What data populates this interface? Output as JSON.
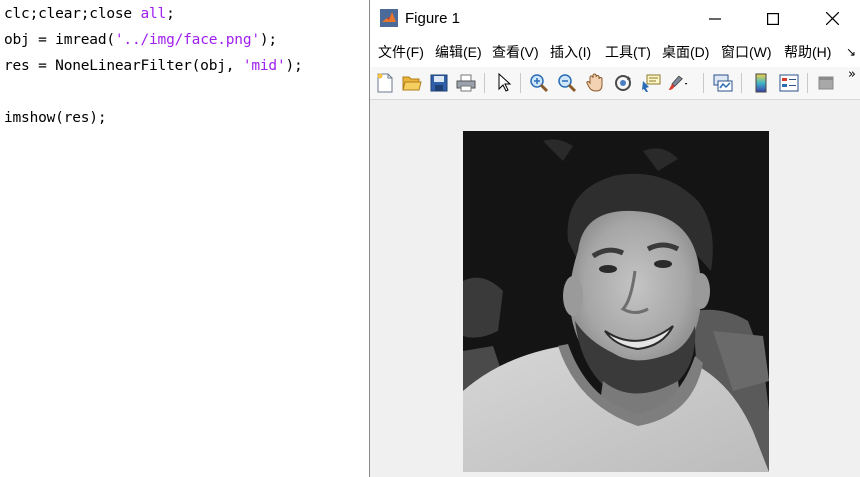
{
  "editor": {
    "lines": [
      {
        "parts": [
          "clc;clear;close ",
          "all",
          ";"
        ]
      },
      {
        "parts": [
          "obj = imread(",
          "'../img/face.png'",
          ");"
        ]
      },
      {
        "parts": [
          "res = NoneLinearFilter(obj, ",
          "'mid'",
          ");"
        ]
      },
      {
        "parts": [
          ""
        ]
      },
      {
        "parts": [
          "imshow(res);"
        ]
      }
    ],
    "string_color": "#a020f0"
  },
  "figure": {
    "title": "Figure 1",
    "window_buttons": {
      "minimize": "minimize-icon",
      "maximize": "maximize-icon",
      "close": "close-icon"
    },
    "menus": [
      "文件(F)",
      "编辑(E)",
      "查看(V)",
      "插入(I)",
      "工具(T)",
      "桌面(D)",
      "窗口(W)",
      "帮助(H)"
    ],
    "menu_overflow": "↘",
    "toolbar_overflow": "»",
    "toolbar": [
      {
        "icon": "new-figure-icon"
      },
      {
        "icon": "open-file-icon"
      },
      {
        "icon": "save-icon"
      },
      {
        "icon": "print-icon"
      },
      {
        "icon": "pointer-icon"
      },
      {
        "icon": "zoom-in-icon"
      },
      {
        "icon": "zoom-out-icon"
      },
      {
        "icon": "pan-hand-icon"
      },
      {
        "icon": "rotate-3d-icon"
      },
      {
        "icon": "data-cursor-icon"
      },
      {
        "icon": "brush-icon"
      },
      {
        "icon": "link-plot-icon"
      },
      {
        "icon": "colorbar-icon"
      },
      {
        "icon": "legend-icon"
      },
      {
        "icon": "hide-plot-tools-icon"
      }
    ],
    "image": {
      "description_icon": "grayscale-portrait-image"
    }
  }
}
